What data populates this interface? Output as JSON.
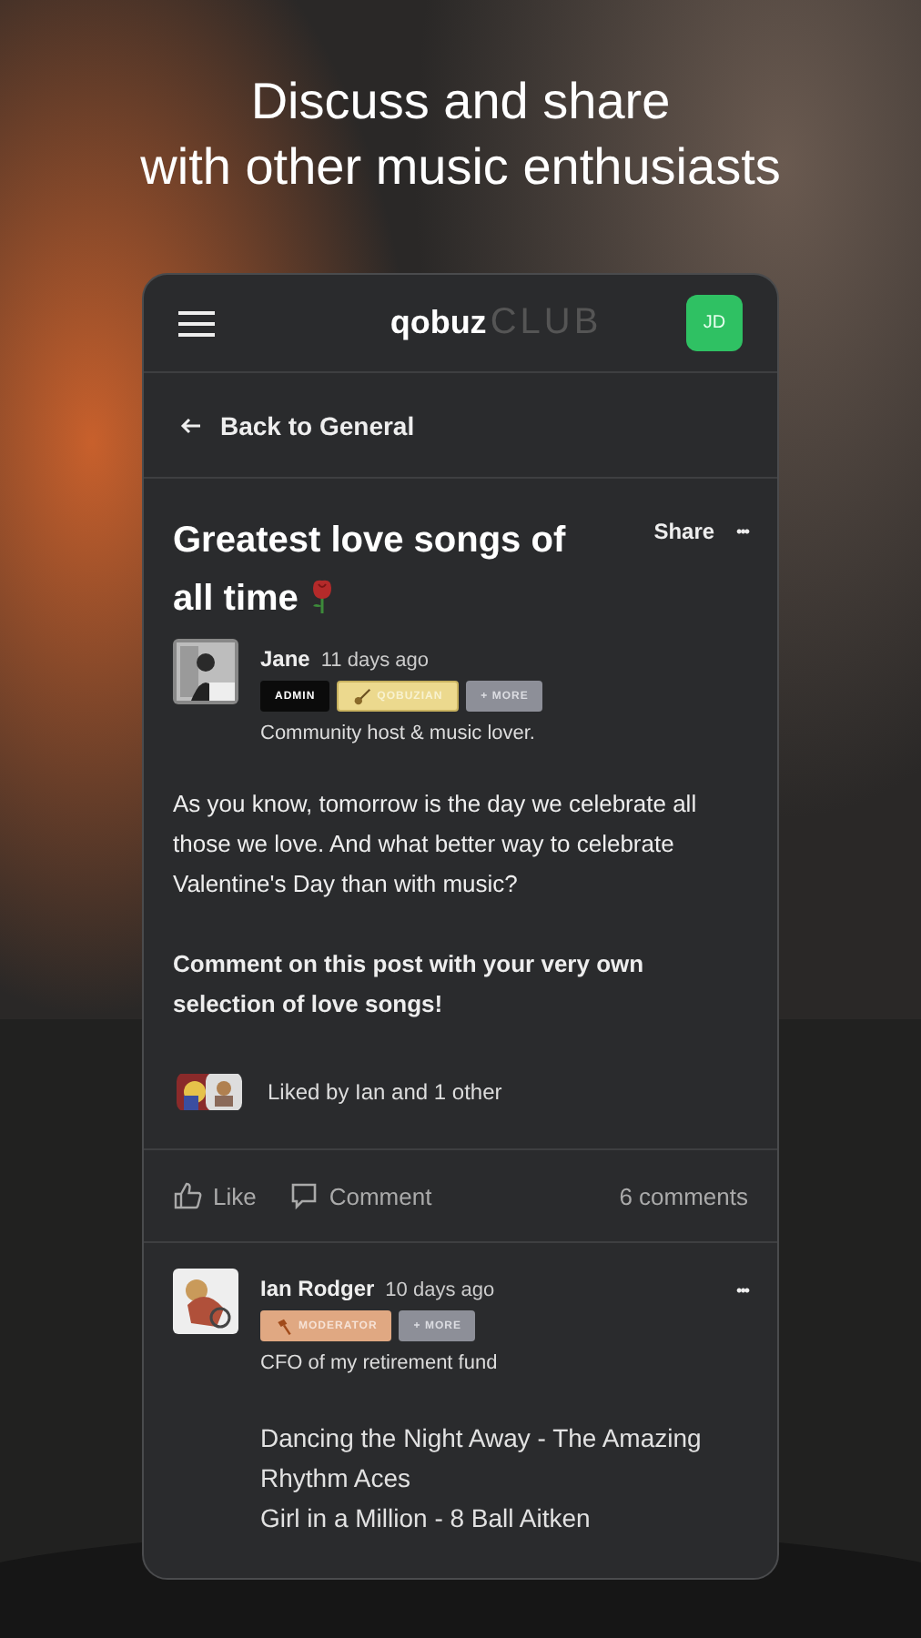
{
  "headline": [
    "Discuss and share",
    "with other music enthusiasts"
  ],
  "header": {
    "logo": "qobuz",
    "logo_suffix": "CLUB",
    "user_initials": "JD"
  },
  "back_link": "Back to General",
  "post": {
    "title": "Greatest love songs of all time",
    "share": "Share",
    "more": "•••",
    "author": {
      "name": "Jane",
      "time": "11 days ago",
      "bio": "Community host & music lover.",
      "badges": [
        {
          "label": "ADMIN",
          "kind": "admin"
        },
        {
          "label": "QOBUZIAN",
          "kind": "qobuzian"
        },
        {
          "label": "+ MORE",
          "kind": "more"
        }
      ]
    },
    "paragraphs": [
      {
        "text": "As you know, tomorrow is the day we celebrate all those we love. And what better way to celebrate Valentine's Day than with music?",
        "bold": false
      },
      {
        "text": "Comment on this post with your very own selection of love songs!",
        "bold": true
      }
    ],
    "likes": "Liked by Ian and 1 other"
  },
  "actions": {
    "like": "Like",
    "comment": "Comment",
    "count": "6 comments"
  },
  "comment": {
    "name": "Ian Rodger",
    "time": "10 days ago",
    "more": "•••",
    "bio": "CFO of my retirement fund",
    "badges": [
      {
        "label": "MODERATOR",
        "kind": "moderator"
      },
      {
        "label": "+ MORE",
        "kind": "more"
      }
    ],
    "lines": [
      "Dancing the Night Away - The Amazing Rhythm Aces",
      "Girl in a Million - 8 Ball Aitken"
    ]
  }
}
